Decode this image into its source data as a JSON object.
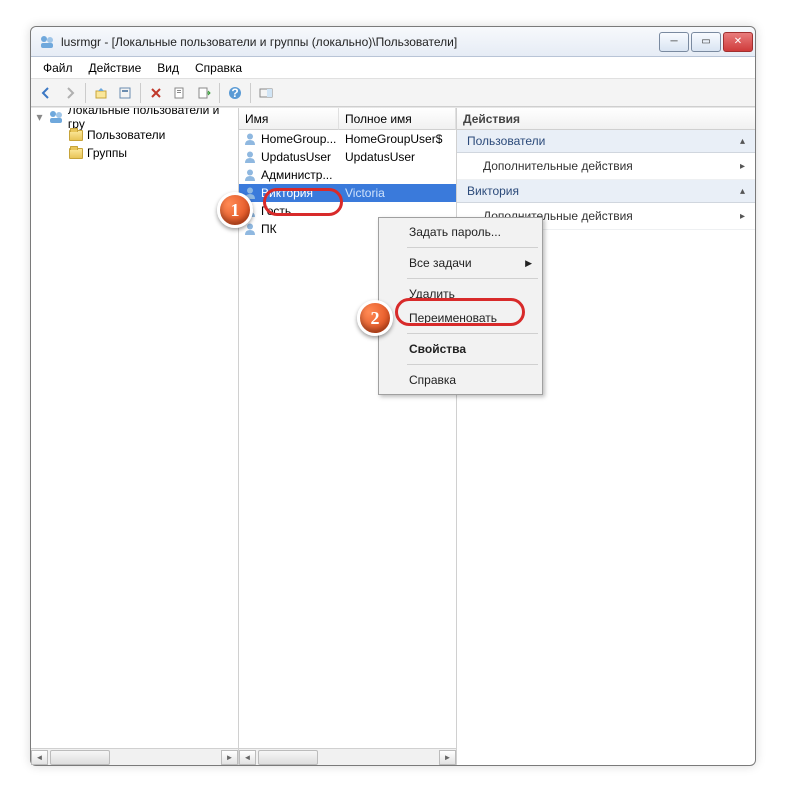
{
  "title": "lusrmgr - [Локальные пользователи и группы (локально)\\Пользователи]",
  "menu": {
    "file": "Файл",
    "action": "Действие",
    "view": "Вид",
    "help": "Справка"
  },
  "tree": {
    "root": "Локальные пользователи и гру",
    "items": [
      "Пользователи",
      "Группы"
    ]
  },
  "list": {
    "col_name": "Имя",
    "col_full": "Полное имя",
    "rows": [
      {
        "name": "HomeGroup...",
        "full": "HomeGroupUser$"
      },
      {
        "name": "UpdatusUser",
        "full": "UpdatusUser"
      },
      {
        "name": "Администр...",
        "full": ""
      },
      {
        "name": "Виктория",
        "full": "Victoria",
        "selected": true
      },
      {
        "name": "Гость",
        "full": ""
      },
      {
        "name": "ПК",
        "full": ""
      }
    ]
  },
  "actions": {
    "header": "Действия",
    "sec1": "Пользователи",
    "sec1_sub": "Дополнительные действия",
    "sec2": "Виктория",
    "sec2_sub": "Дополнительные действия"
  },
  "context": {
    "set_password": "Задать пароль...",
    "all_tasks": "Все задачи",
    "delete": "Удалить",
    "rename": "Переименовать",
    "properties": "Свойства",
    "help": "Справка"
  },
  "badges": {
    "b1": "1",
    "b2": "2"
  }
}
